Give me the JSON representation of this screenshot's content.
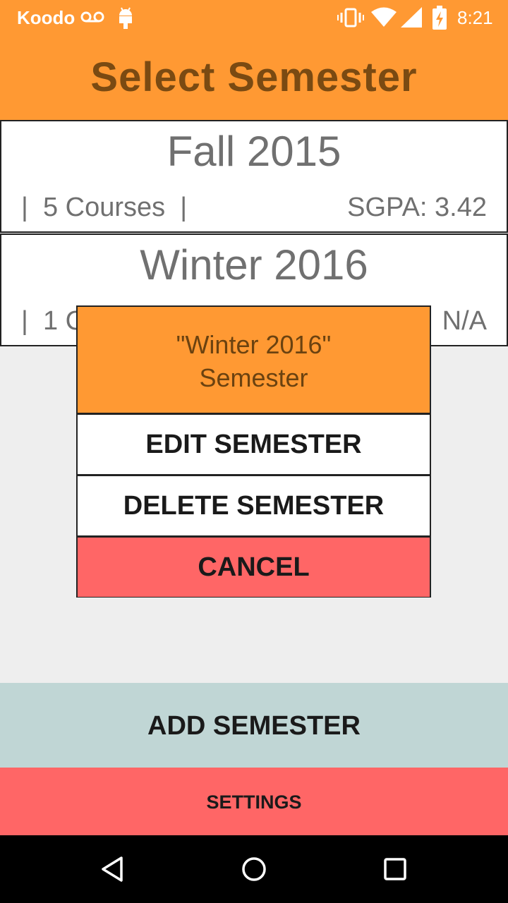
{
  "status_bar": {
    "carrier": "Koodo",
    "time": "8:21",
    "icons": [
      "voicemail-icon",
      "android-icon",
      "vibrate-icon",
      "wifi-icon",
      "signal-icon",
      "battery-charging-icon"
    ]
  },
  "header": {
    "title": "Select Semester"
  },
  "semesters": [
    {
      "name": "Fall 2015",
      "courses": "|  5 Courses  |",
      "sgpa": "SGPA: 3.42"
    },
    {
      "name": "Winter 2016",
      "courses": "|  1 C",
      "sgpa": "N/A"
    }
  ],
  "dialog": {
    "title_line1": "\"Winter 2016\"",
    "title_line2": "Semester",
    "edit_label": "EDIT SEMESTER",
    "delete_label": "DELETE SEMESTER",
    "cancel_label": "CANCEL"
  },
  "bottom": {
    "add_label": "ADD SEMESTER",
    "settings_label": "SETTINGS"
  },
  "colors": {
    "header_bg": "#ff9933",
    "title_text": "#7a4a12",
    "cancel_bg": "#ff6666",
    "add_bg": "#c0d6d5",
    "settings_bg": "#ff6666"
  }
}
